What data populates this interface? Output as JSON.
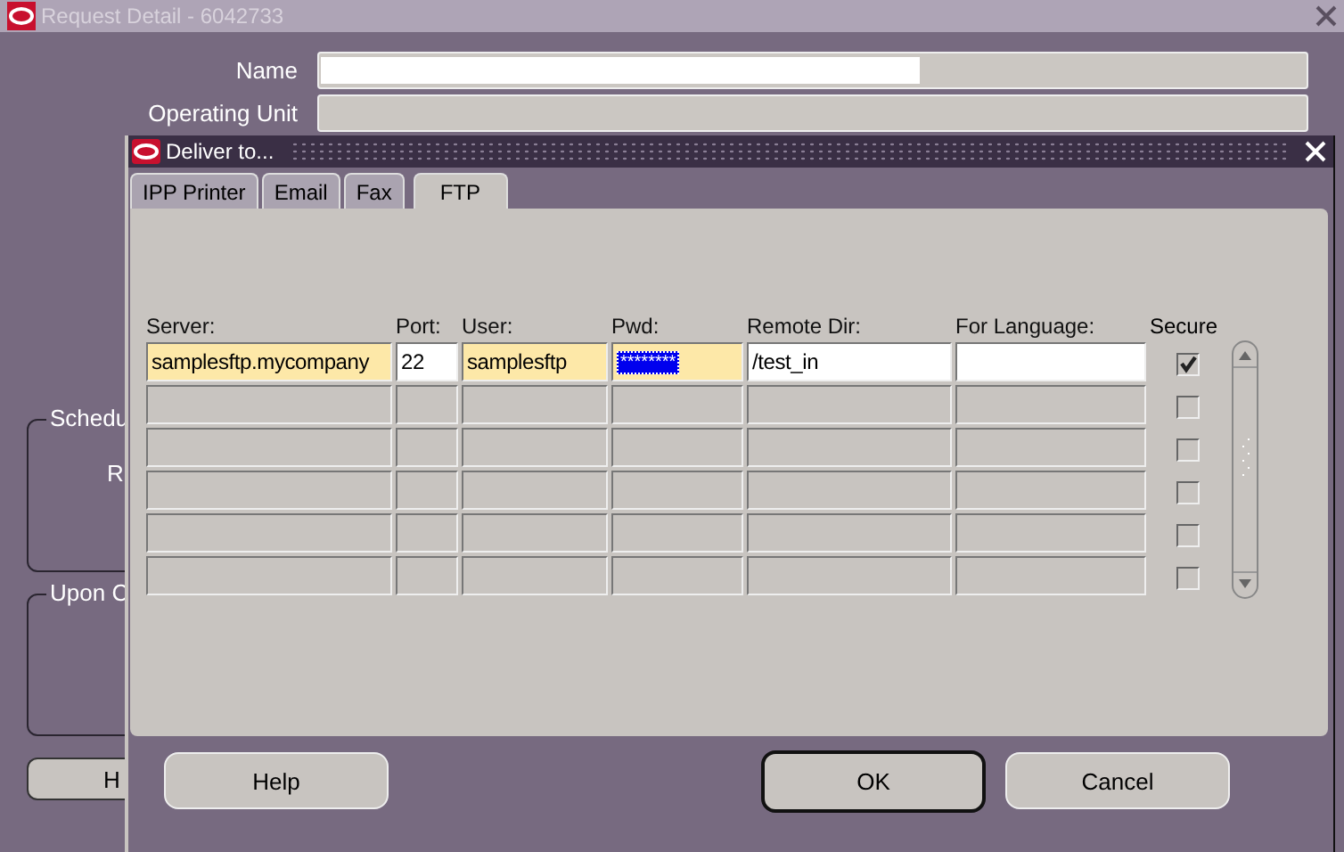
{
  "window": {
    "title": "Request Detail - 6042733"
  },
  "form": [
    {
      "label": "Name"
    },
    {
      "label": "Operating Unit"
    }
  ],
  "left_groups": [
    {
      "title": "Schedu",
      "text": "R"
    },
    {
      "title": "Upon C"
    }
  ],
  "left_button": {
    "label": "H"
  },
  "dialog": {
    "title": "Deliver to...",
    "tabs": [
      {
        "label": "IPP Printer",
        "selected": false
      },
      {
        "label": "Email",
        "selected": false
      },
      {
        "label": "Fax",
        "selected": false
      },
      {
        "label": "FTP",
        "selected": true
      }
    ],
    "columns": [
      {
        "label": "Server:",
        "required": true
      },
      {
        "label": "Port:",
        "required": false
      },
      {
        "label": "User:",
        "required": true
      },
      {
        "label": "Pwd:",
        "required": true
      },
      {
        "label": "Remote Dir:",
        "required": false
      },
      {
        "label": "For Language:",
        "required": false
      }
    ],
    "secure_label": "Secure",
    "rows": [
      {
        "enabled": true,
        "cells": [
          "samplesftp.mycompany",
          "22",
          "samplesftp",
          "********",
          "/test_in"
        ],
        "password_selected": true,
        "secure": true
      },
      {
        "enabled": false,
        "secure": false
      },
      {
        "enabled": false,
        "secure": false
      },
      {
        "enabled": false,
        "secure": false
      },
      {
        "enabled": false,
        "secure": false
      },
      {
        "enabled": false,
        "secure": false
      }
    ],
    "buttons": [
      {
        "label": "Help",
        "default": false
      },
      {
        "label": "OK",
        "default": true
      },
      {
        "label": "Cancel",
        "default": false
      }
    ]
  }
}
